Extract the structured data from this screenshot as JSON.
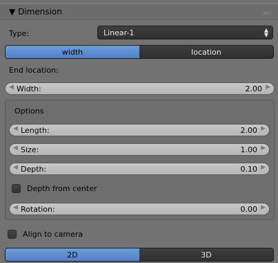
{
  "header": {
    "title": "Dimension",
    "expand_glyph": "▼"
  },
  "type_row": {
    "label": "Type:",
    "value": "Linear-1"
  },
  "mode_tabs": [
    {
      "label": "width",
      "active": true
    },
    {
      "label": "location",
      "active": false
    }
  ],
  "end_location": {
    "label": "End location:",
    "width": {
      "label": "Width:",
      "value": "2.00"
    }
  },
  "options": {
    "label": "Options",
    "length": {
      "label": "Length:",
      "value": "2.00"
    },
    "size": {
      "label": "Size:",
      "value": "1.00"
    },
    "depth": {
      "label": "Depth:",
      "value": "0.10"
    },
    "depth_from_center": {
      "label": "Depth from center",
      "checked": false
    },
    "rotation": {
      "label": "Rotation:",
      "value": "0.00"
    }
  },
  "align_to_camera": {
    "label": "Align to camera",
    "checked": false
  },
  "view_tabs": [
    {
      "label": "2D",
      "active": true
    },
    {
      "label": "3D",
      "active": false
    }
  ],
  "colors": {
    "accent": "#5e8fd4",
    "panel": "#727272",
    "dark_button": "#353535"
  }
}
